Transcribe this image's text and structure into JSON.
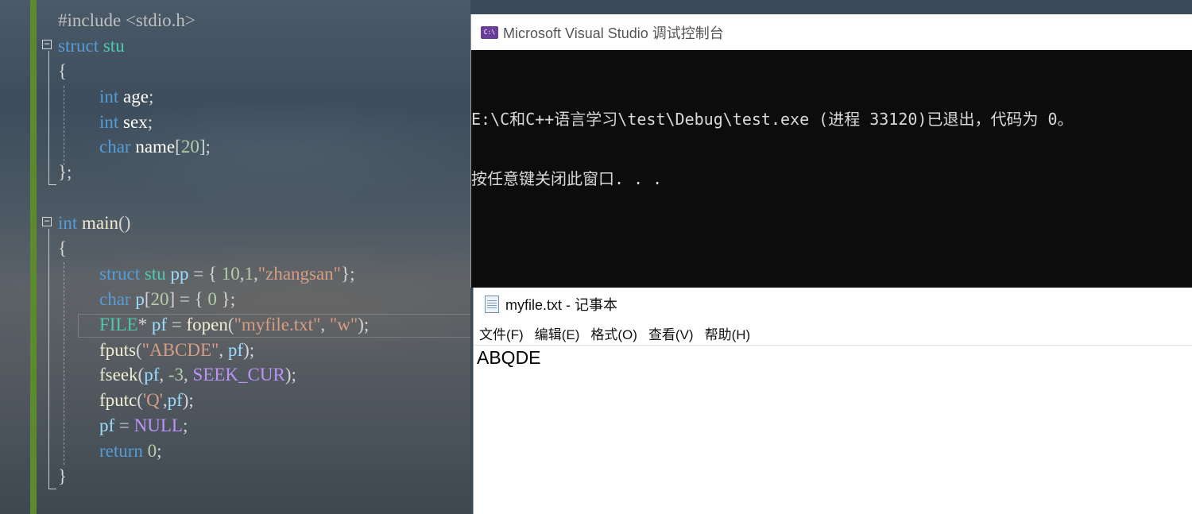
{
  "editor": {
    "code": [
      {
        "parts": [
          {
            "c": "pp",
            "t": "#include <stdio.h>"
          }
        ]
      },
      {
        "fold": "−",
        "parts": [
          {
            "c": "kw",
            "t": "struct"
          },
          {
            "c": "pu",
            "t": " "
          },
          {
            "c": "ty",
            "t": "stu"
          }
        ]
      },
      {
        "parts": [
          {
            "c": "pu",
            "t": "{"
          }
        ]
      },
      {
        "indent": true,
        "parts": [
          {
            "c": "kw",
            "t": "int"
          },
          {
            "c": "pu",
            "t": " "
          },
          {
            "c": "id",
            "t": "age"
          },
          {
            "c": "pu",
            "t": ";"
          }
        ]
      },
      {
        "indent": true,
        "parts": [
          {
            "c": "kw",
            "t": "int"
          },
          {
            "c": "pu",
            "t": " "
          },
          {
            "c": "id",
            "t": "sex"
          },
          {
            "c": "pu",
            "t": ";"
          }
        ]
      },
      {
        "indent": true,
        "parts": [
          {
            "c": "kw",
            "t": "char"
          },
          {
            "c": "pu",
            "t": " "
          },
          {
            "c": "id",
            "t": "name"
          },
          {
            "c": "pu",
            "t": "["
          },
          {
            "c": "nu",
            "t": "20"
          },
          {
            "c": "pu",
            "t": "];"
          }
        ]
      },
      {
        "parts": [
          {
            "c": "pu",
            "t": "};"
          }
        ]
      },
      {
        "parts": [
          {
            "c": "pu",
            "t": ""
          }
        ]
      },
      {
        "fold": "−",
        "parts": [
          {
            "c": "kw",
            "t": "int"
          },
          {
            "c": "pu",
            "t": " "
          },
          {
            "c": "fn",
            "t": "main"
          },
          {
            "c": "pu",
            "t": "()"
          }
        ]
      },
      {
        "parts": [
          {
            "c": "pu",
            "t": "{"
          }
        ]
      },
      {
        "indent": true,
        "parts": [
          {
            "c": "kw",
            "t": "struct"
          },
          {
            "c": "pu",
            "t": " "
          },
          {
            "c": "ty",
            "t": "stu"
          },
          {
            "c": "pu",
            "t": " "
          },
          {
            "c": "var",
            "t": "pp"
          },
          {
            "c": "pu",
            "t": " = { "
          },
          {
            "c": "nu",
            "t": "10"
          },
          {
            "c": "pu",
            "t": ","
          },
          {
            "c": "nu",
            "t": "1"
          },
          {
            "c": "pu",
            "t": ","
          },
          {
            "c": "st",
            "t": "\"zhangsan\""
          },
          {
            "c": "pu",
            "t": "};"
          }
        ]
      },
      {
        "indent": true,
        "parts": [
          {
            "c": "kw",
            "t": "char"
          },
          {
            "c": "pu",
            "t": " "
          },
          {
            "c": "var",
            "t": "p"
          },
          {
            "c": "pu",
            "t": "["
          },
          {
            "c": "nu",
            "t": "20"
          },
          {
            "c": "pu",
            "t": "] = { "
          },
          {
            "c": "nu",
            "t": "0"
          },
          {
            "c": "pu",
            "t": " };"
          }
        ]
      },
      {
        "indent": true,
        "highlight": true,
        "parts": [
          {
            "c": "ty",
            "t": "FILE"
          },
          {
            "c": "pu",
            "t": "* "
          },
          {
            "c": "var",
            "t": "pf"
          },
          {
            "c": "pu",
            "t": " = "
          },
          {
            "c": "fn",
            "t": "fopen"
          },
          {
            "c": "pu",
            "t": "("
          },
          {
            "c": "st",
            "t": "\"myfile.txt\""
          },
          {
            "c": "pu",
            "t": ", "
          },
          {
            "c": "st",
            "t": "\"w\""
          },
          {
            "c": "pu",
            "t": ");"
          }
        ]
      },
      {
        "indent": true,
        "parts": [
          {
            "c": "fn",
            "t": "fputs"
          },
          {
            "c": "pu",
            "t": "("
          },
          {
            "c": "st",
            "t": "\"ABCDE\""
          },
          {
            "c": "pu",
            "t": ", "
          },
          {
            "c": "var",
            "t": "pf"
          },
          {
            "c": "pu",
            "t": ");"
          }
        ]
      },
      {
        "indent": true,
        "parts": [
          {
            "c": "fn",
            "t": "fseek"
          },
          {
            "c": "pu",
            "t": "("
          },
          {
            "c": "var",
            "t": "pf"
          },
          {
            "c": "pu",
            "t": ", "
          },
          {
            "c": "nu",
            "t": "-3"
          },
          {
            "c": "pu",
            "t": ", "
          },
          {
            "c": "mac",
            "t": "SEEK_CUR"
          },
          {
            "c": "pu",
            "t": ");"
          }
        ]
      },
      {
        "indent": true,
        "parts": [
          {
            "c": "fn",
            "t": "fputc"
          },
          {
            "c": "pu",
            "t": "("
          },
          {
            "c": "st",
            "t": "'Q'"
          },
          {
            "c": "pu",
            "t": ","
          },
          {
            "c": "var",
            "t": "pf"
          },
          {
            "c": "pu",
            "t": ");"
          }
        ]
      },
      {
        "indent": true,
        "parts": [
          {
            "c": "var",
            "t": "pf"
          },
          {
            "c": "pu",
            "t": " = "
          },
          {
            "c": "mac",
            "t": "NULL"
          },
          {
            "c": "pu",
            "t": ";"
          }
        ]
      },
      {
        "indent": true,
        "parts": [
          {
            "c": "kw",
            "t": "return"
          },
          {
            "c": "pu",
            "t": " "
          },
          {
            "c": "nu",
            "t": "0"
          },
          {
            "c": "pu",
            "t": ";"
          }
        ]
      },
      {
        "parts": [
          {
            "c": "pu",
            "t": "}"
          }
        ]
      }
    ]
  },
  "console": {
    "title": "Microsoft Visual Studio 调试控制台",
    "icon": "console-app-icon",
    "lines": [
      "E:\\C和C++语言学习\\test\\Debug\\test.exe (进程 33120)已退出，代码为 0。",
      "按任意键关闭此窗口. . ."
    ]
  },
  "notepad": {
    "title": "myfile.txt - 记事本",
    "icon": "notepad-icon",
    "menu": [
      "文件(F)",
      "编辑(E)",
      "格式(O)",
      "查看(V)",
      "帮助(H)"
    ],
    "content": "ABQDE"
  }
}
